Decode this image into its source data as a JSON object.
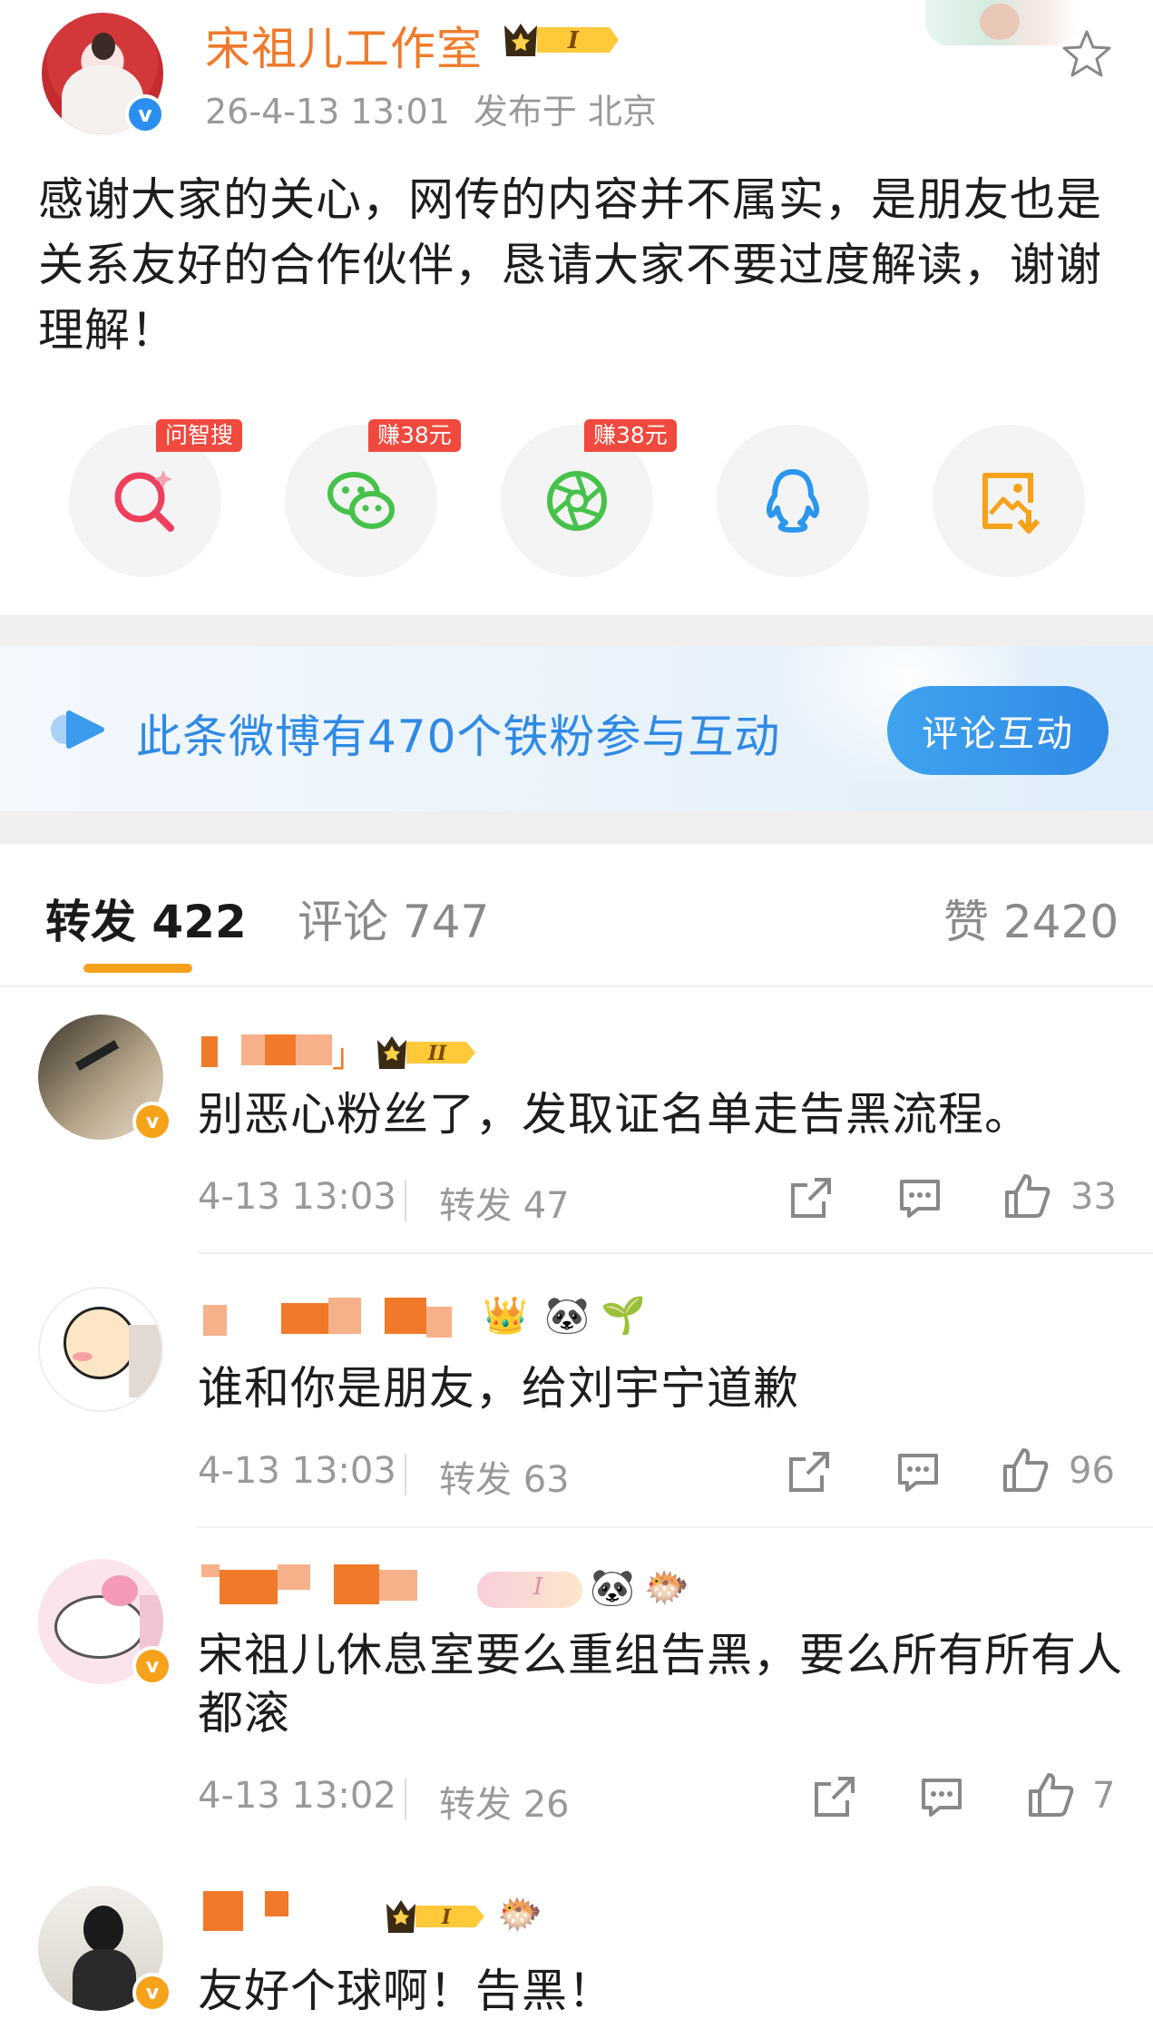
{
  "post": {
    "author": "宋祖儿工作室",
    "vip_level": "I",
    "date": "26-4-13 13:01",
    "location": "发布于 北京",
    "text": "感谢大家的关心，网传的内容并不属实，是朋友也是关系友好的合作伙伴，恳请大家不要过度解读，谢谢理解！"
  },
  "share": {
    "items": [
      {
        "icon": "ai-search-icon",
        "tag": "问智搜",
        "color": "#ef3f5e"
      },
      {
        "icon": "wechat-icon",
        "tag": "赚38元",
        "color": "#46c24a"
      },
      {
        "icon": "moments-icon",
        "tag": "赚38元",
        "color": "#46c24a"
      },
      {
        "icon": "qq-icon",
        "tag": "",
        "color": "#2a97ee"
      },
      {
        "icon": "save-image-icon",
        "tag": "",
        "color": "#f6a21a"
      }
    ]
  },
  "fans_banner": {
    "text": "此条微博有470个铁粉参与互动",
    "button": "评论互动"
  },
  "tabs": {
    "repost": "转发 422",
    "comments": "评论 747",
    "likes": "赞 2420"
  },
  "reposts": [
    {
      "name_tail": "」",
      "badge": "II",
      "text": "别恶心粉丝了，发取证名单走告黑流程。",
      "time": "4-13 13:03",
      "repost": "转发 47",
      "likes": "33"
    },
    {
      "name_tail": "",
      "badge": "",
      "text": "谁和你是朋友，给刘宇宁道歉",
      "time": "4-13 13:03",
      "repost": "转发 63",
      "likes": "96"
    },
    {
      "name_tail": "",
      "badge": "I",
      "text": "宋祖儿休息室要么重组告黑，要么所有所有人都滚",
      "time": "4-13 13:02",
      "repost": "转发 26",
      "likes": "7"
    },
    {
      "name_tail": "",
      "badge": "I",
      "text": "友好个球啊！告黑！",
      "time": "",
      "repost": "",
      "likes": ""
    }
  ]
}
